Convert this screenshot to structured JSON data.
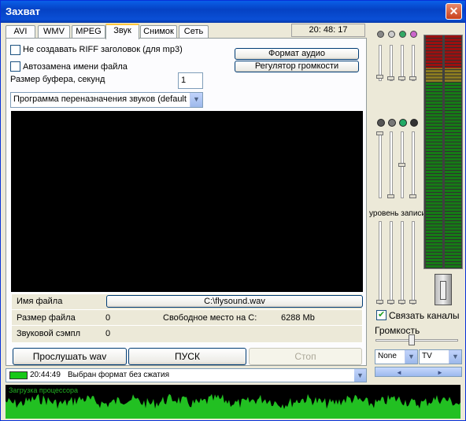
{
  "window": {
    "title": "Захват",
    "close_label": "✕"
  },
  "tabs": [
    {
      "label": "AVI"
    },
    {
      "label": "WMV"
    },
    {
      "label": "MPEG"
    },
    {
      "label": "Звук",
      "active": true
    },
    {
      "label": "Снимок"
    },
    {
      "label": "Сеть"
    }
  ],
  "clock": "20: 48: 17",
  "sound": {
    "no_riff_label": "Не создавать RIFF заголовок (для mp3)",
    "autoreplace_label": "Автозамена имени файла",
    "buffer_label": "Размер буфера, секунд",
    "buffer_value": "1",
    "audio_format_button": "Формат аудио",
    "volume_control_button": "Регулятор громкости",
    "sound_mapper_value": "Программа переназначения звуков (default"
  },
  "file_info": {
    "filename_label": "Имя файла",
    "filename_value": "C:\\flysound.wav",
    "filesize_label": "Размер файла",
    "filesize_value": "0",
    "freespace_label": "Свободное место на C:",
    "freespace_value": "6288 Mb",
    "samples_label": "Звуковой сэмпл",
    "samples_value": "0"
  },
  "buttons": {
    "listen": "Прослушать wav",
    "start": "ПУСК",
    "stop": "Стоп"
  },
  "status": {
    "time": "20:44:49",
    "message": "Выбран формат без сжатия"
  },
  "cpu_label": "Загрузка процессора",
  "mixer": {
    "record_level_label": "уровень записи",
    "link_channels_label": "Связать каналы",
    "volume_label": "Громкость",
    "select1_value": "None",
    "select2_value": "TV"
  },
  "colors": {
    "accent": "#0a4fd6",
    "vu_red": "#9b1010",
    "vu_yellow": "#8a7a20",
    "vu_green": "#167a16",
    "cpu_wave": "#22c022"
  }
}
